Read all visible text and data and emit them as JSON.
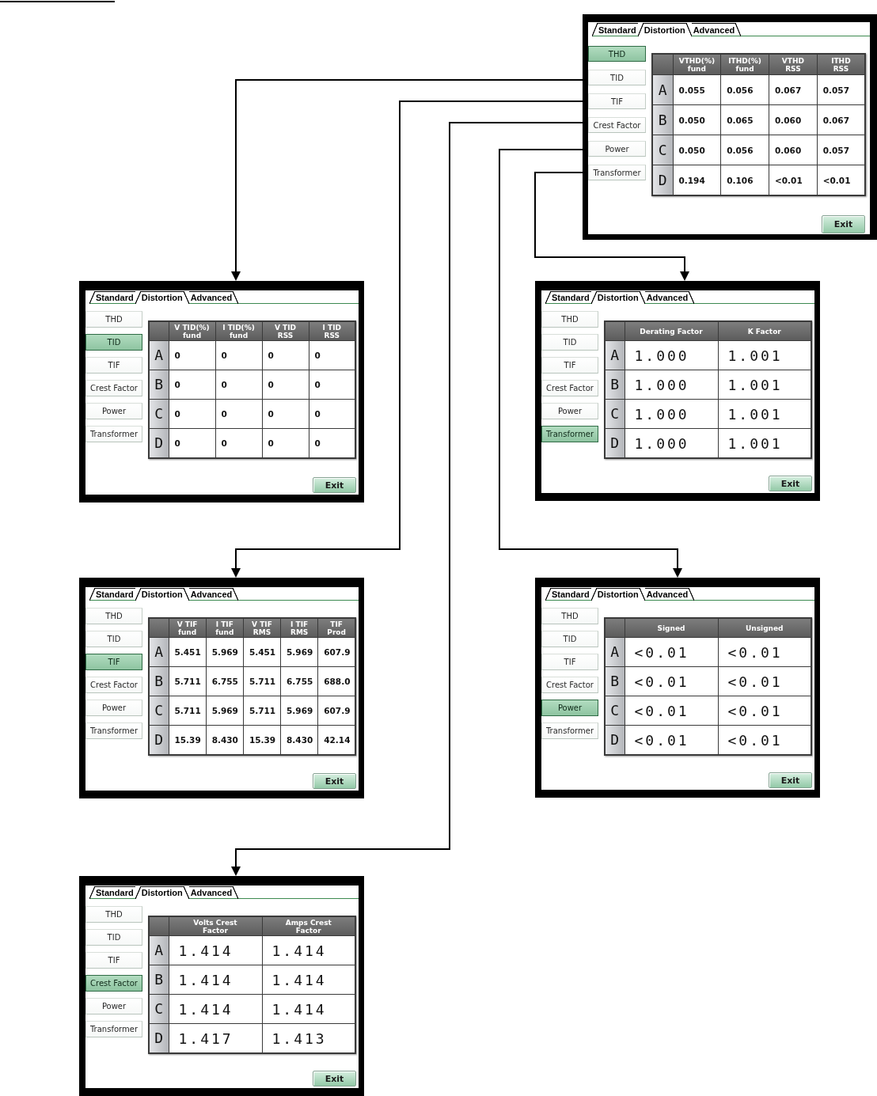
{
  "panels": [
    {
      "tabs": [
        {
          "label": "Standard",
          "selected": false
        },
        {
          "label": "Distortion",
          "selected": true
        },
        {
          "label": "Advanced",
          "selected": false
        }
      ],
      "menu": [
        {
          "label": "THD",
          "selected": true
        },
        {
          "label": "TID",
          "selected": false
        },
        {
          "label": "TIF",
          "selected": false
        },
        {
          "label": "Crest Factor",
          "selected": false
        },
        {
          "label": "Power",
          "selected": false
        },
        {
          "label": "Transformer",
          "selected": false
        }
      ],
      "table": {
        "columns": [
          "VTHD(%)\nfund",
          "ITHD(%)\nfund",
          "VTHD\nRSS",
          "ITHD\nRSS"
        ],
        "rows": [
          {
            "label": "A",
            "cells": [
              "0.055",
              "0.056",
              "0.067",
              "0.057"
            ]
          },
          {
            "label": "B",
            "cells": [
              "0.050",
              "0.065",
              "0.060",
              "0.067"
            ]
          },
          {
            "label": "C",
            "cells": [
              "0.050",
              "0.056",
              "0.060",
              "0.057"
            ]
          },
          {
            "label": "D",
            "cells": [
              "0.194",
              "0.106",
              "<0.01",
              "<0.01"
            ]
          }
        ]
      },
      "exit_button": "Exit"
    },
    {
      "tabs": [
        {
          "label": "Standard",
          "selected": false
        },
        {
          "label": "Distortion",
          "selected": true
        },
        {
          "label": "Advanced",
          "selected": false
        }
      ],
      "menu": [
        {
          "label": "THD",
          "selected": false
        },
        {
          "label": "TID",
          "selected": true
        },
        {
          "label": "TIF",
          "selected": false
        },
        {
          "label": "Crest Factor",
          "selected": false
        },
        {
          "label": "Power",
          "selected": false
        },
        {
          "label": "Transformer",
          "selected": false
        }
      ],
      "table": {
        "columns": [
          "V TID(%)\nfund",
          "I TID(%)\nfund",
          "V TID\nRSS",
          "I TID\nRSS"
        ],
        "rows": [
          {
            "label": "A",
            "cells": [
              "0",
              "0",
              "0",
              "0"
            ]
          },
          {
            "label": "B",
            "cells": [
              "0",
              "0",
              "0",
              "0"
            ]
          },
          {
            "label": "C",
            "cells": [
              "0",
              "0",
              "0",
              "0"
            ]
          },
          {
            "label": "D",
            "cells": [
              "0",
              "0",
              "0",
              "0"
            ]
          }
        ]
      },
      "exit_button": "Exit"
    },
    {
      "tabs": [
        {
          "label": "Standard",
          "selected": false
        },
        {
          "label": "Distortion",
          "selected": true
        },
        {
          "label": "Advanced",
          "selected": false
        }
      ],
      "menu": [
        {
          "label": "THD",
          "selected": false
        },
        {
          "label": "TID",
          "selected": false
        },
        {
          "label": "TIF",
          "selected": false
        },
        {
          "label": "Crest Factor",
          "selected": false
        },
        {
          "label": "Power",
          "selected": false
        },
        {
          "label": "Transformer",
          "selected": true
        }
      ],
      "table": {
        "columns": [
          "Derating Factor",
          "K Factor"
        ],
        "rows": [
          {
            "label": "A",
            "cells": [
              "1.000",
              "1.001"
            ]
          },
          {
            "label": "B",
            "cells": [
              "1.000",
              "1.001"
            ]
          },
          {
            "label": "C",
            "cells": [
              "1.000",
              "1.001"
            ]
          },
          {
            "label": "D",
            "cells": [
              "1.000",
              "1.001"
            ]
          }
        ]
      },
      "exit_button": "Exit"
    },
    {
      "tabs": [
        {
          "label": "Standard",
          "selected": false
        },
        {
          "label": "Distortion",
          "selected": true
        },
        {
          "label": "Advanced",
          "selected": false
        }
      ],
      "menu": [
        {
          "label": "THD",
          "selected": false
        },
        {
          "label": "TID",
          "selected": false
        },
        {
          "label": "TIF",
          "selected": true
        },
        {
          "label": "Crest Factor",
          "selected": false
        },
        {
          "label": "Power",
          "selected": false
        },
        {
          "label": "Transformer",
          "selected": false
        }
      ],
      "table": {
        "columns": [
          "V TIF\nfund",
          "I TIF\nfund",
          "V TIF\nRMS",
          "I TIF\nRMS",
          "TIF\nProd"
        ],
        "rows": [
          {
            "label": "A",
            "cells": [
              "5.451",
              "5.969",
              "5.451",
              "5.969",
              "607.9"
            ]
          },
          {
            "label": "B",
            "cells": [
              "5.711",
              "6.755",
              "5.711",
              "6.755",
              "688.0"
            ]
          },
          {
            "label": "C",
            "cells": [
              "5.711",
              "5.969",
              "5.711",
              "5.969",
              "607.9"
            ]
          },
          {
            "label": "D",
            "cells": [
              "15.39",
              "8.430",
              "15.39",
              "8.430",
              "42.14"
            ]
          }
        ]
      },
      "exit_button": "Exit"
    },
    {
      "tabs": [
        {
          "label": "Standard",
          "selected": false
        },
        {
          "label": "Distortion",
          "selected": true
        },
        {
          "label": "Advanced",
          "selected": false
        }
      ],
      "menu": [
        {
          "label": "THD",
          "selected": false
        },
        {
          "label": "TID",
          "selected": false
        },
        {
          "label": "TIF",
          "selected": false
        },
        {
          "label": "Crest Factor",
          "selected": false
        },
        {
          "label": "Power",
          "selected": true
        },
        {
          "label": "Transformer",
          "selected": false
        }
      ],
      "table": {
        "columns": [
          "Signed",
          "Unsigned"
        ],
        "rows": [
          {
            "label": "A",
            "cells": [
              "<0.01",
              "<0.01"
            ]
          },
          {
            "label": "B",
            "cells": [
              "<0.01",
              "<0.01"
            ]
          },
          {
            "label": "C",
            "cells": [
              "<0.01",
              "<0.01"
            ]
          },
          {
            "label": "D",
            "cells": [
              "<0.01",
              "<0.01"
            ]
          }
        ]
      },
      "exit_button": "Exit"
    },
    {
      "tabs": [
        {
          "label": "Standard",
          "selected": false
        },
        {
          "label": "Distortion",
          "selected": true
        },
        {
          "label": "Advanced",
          "selected": false
        }
      ],
      "menu": [
        {
          "label": "THD",
          "selected": false
        },
        {
          "label": "TID",
          "selected": false
        },
        {
          "label": "TIF",
          "selected": false
        },
        {
          "label": "Crest Factor",
          "selected": true
        },
        {
          "label": "Power",
          "selected": false
        },
        {
          "label": "Transformer",
          "selected": false
        }
      ],
      "table": {
        "columns": [
          "Volts Crest\nFactor",
          "Amps Crest\nFactor"
        ],
        "rows": [
          {
            "label": "A",
            "cells": [
              "1.414",
              "1.414"
            ]
          },
          {
            "label": "B",
            "cells": [
              "1.414",
              "1.414"
            ]
          },
          {
            "label": "C",
            "cells": [
              "1.414",
              "1.414"
            ]
          },
          {
            "label": "D",
            "cells": [
              "1.417",
              "1.413"
            ]
          }
        ]
      },
      "exit_button": "Exit"
    }
  ]
}
